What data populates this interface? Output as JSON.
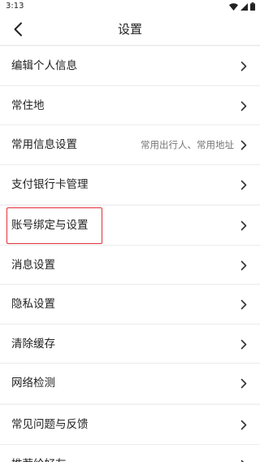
{
  "status_bar": {
    "time": "3:13"
  },
  "nav": {
    "title": "设置",
    "back_icon": "chevron-left-icon"
  },
  "groups": [
    {
      "items": [
        {
          "label": "编辑个人信息",
          "value": ""
        },
        {
          "label": "常住地",
          "value": ""
        },
        {
          "label": "常用信息设置",
          "value": "常用出行人、常用地址"
        },
        {
          "label": "支付银行卡管理",
          "value": ""
        }
      ]
    },
    {
      "items": [
        {
          "label": "账号绑定与设置",
          "value": "",
          "highlighted": true
        },
        {
          "label": "消息设置",
          "value": ""
        },
        {
          "label": "隐私设置",
          "value": ""
        },
        {
          "label": "清除缓存",
          "value": ""
        },
        {
          "label": "网络检测",
          "value": ""
        }
      ]
    },
    {
      "items": [
        {
          "label": "常见问题与反馈",
          "value": ""
        },
        {
          "label": "推荐给好友",
          "value": ""
        }
      ]
    }
  ],
  "colors": {
    "highlight_border": "#e0303a",
    "separator": "#f2f2f2"
  },
  "icons": {
    "row_chevron": "chevron-right-icon"
  }
}
